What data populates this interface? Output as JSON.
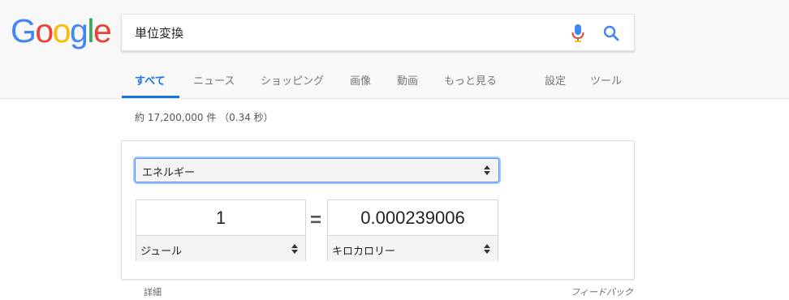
{
  "logo": {
    "text": [
      "G",
      "o",
      "o",
      "g",
      "l",
      "e"
    ],
    "colors": [
      "#4285f4",
      "#ea4335",
      "#fbbc05",
      "#4285f4",
      "#34a853",
      "#ea4335"
    ]
  },
  "search": {
    "query": "単位変換"
  },
  "icons": {
    "mic": "microphone-icon",
    "search": "search-icon",
    "select": "up-down-arrows-icon"
  },
  "tabs": [
    {
      "label": "すべて",
      "active": true
    },
    {
      "label": "ニュース"
    },
    {
      "label": "ショッピング"
    },
    {
      "label": "画像"
    },
    {
      "label": "動画"
    },
    {
      "label": "もっと見る"
    },
    {
      "label": "設定"
    },
    {
      "label": "ツール"
    }
  ],
  "result_stats": "約 17,200,000 件 （0.34 秒）",
  "converter": {
    "unit_type": "エネルギー",
    "from": {
      "value": "1",
      "unit": "ジュール"
    },
    "equals": "=",
    "to": {
      "value": "0.000239006",
      "unit": "キロカロリー"
    }
  },
  "footer": {
    "details": "詳細",
    "feedback": "フィードバック"
  },
  "colors": {
    "accent": "#1a73e8",
    "focus": "#4d90fe"
  }
}
